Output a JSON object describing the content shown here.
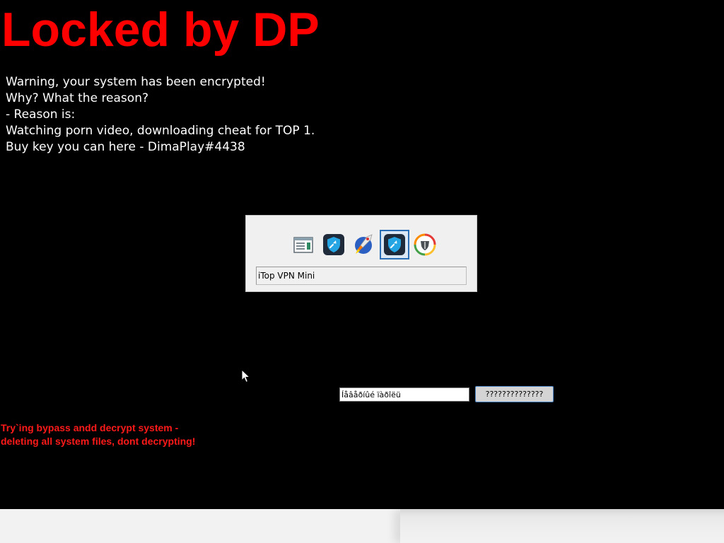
{
  "lock_screen": {
    "title": "Locked by DP",
    "warning_lines": [
      "Warning, your system has been encrypted!",
      "Why? What the reason?",
      "- Reason is:",
      "Watching porn video, downloading cheat for TOP 1.",
      "Buy key you can here - DimaPlay#4438"
    ],
    "key_input_value": "Íåâåðíûé ïàðîëü",
    "unlock_button_label": "??????????????",
    "threat_lines": [
      "Try`ing bypass andd decrypt system -",
      "deleting all system files, dont decrypting!"
    ],
    "colors": {
      "background": "#000000",
      "title": "#ff0000",
      "warning_text": "#ffffff",
      "threat_text": "#ff1a1a"
    }
  },
  "task_switcher": {
    "apps": [
      {
        "icon": "window-app-icon"
      },
      {
        "icon": "itop-vpn-icon"
      },
      {
        "icon": "rocket-app-icon"
      },
      {
        "icon": "itop-vpn-mini-icon",
        "selected": true
      },
      {
        "icon": "shield-speedometer-icon"
      }
    ],
    "selected_label": "iTop VPN Mini",
    "selected_color": "#2a6fb6"
  }
}
